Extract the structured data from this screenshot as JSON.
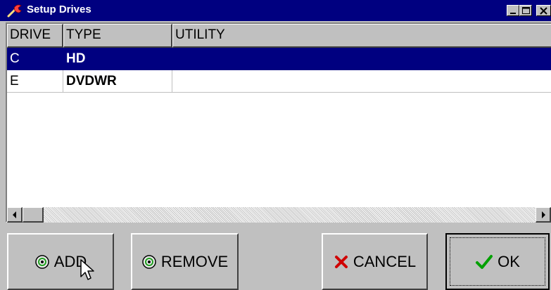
{
  "window": {
    "title": "Setup Drives",
    "title_bar_color": "#000080"
  },
  "table": {
    "columns": [
      "DRIVE",
      "TYPE",
      "UTILITY"
    ],
    "rows": [
      {
        "drive": "C",
        "type": "HD",
        "utility": "",
        "selected": true
      },
      {
        "drive": "E",
        "type": "DVDWR",
        "utility": "",
        "selected": false
      }
    ],
    "selection_color": "#000080"
  },
  "buttons": {
    "add": "ADD",
    "remove": "REMOVE",
    "cancel": "CANCEL",
    "ok": "OK"
  },
  "icons": {
    "title": "wrench-icon",
    "add": "disc-icon",
    "remove": "disc-icon",
    "cancel": "red-x-icon",
    "ok": "green-check-icon"
  }
}
